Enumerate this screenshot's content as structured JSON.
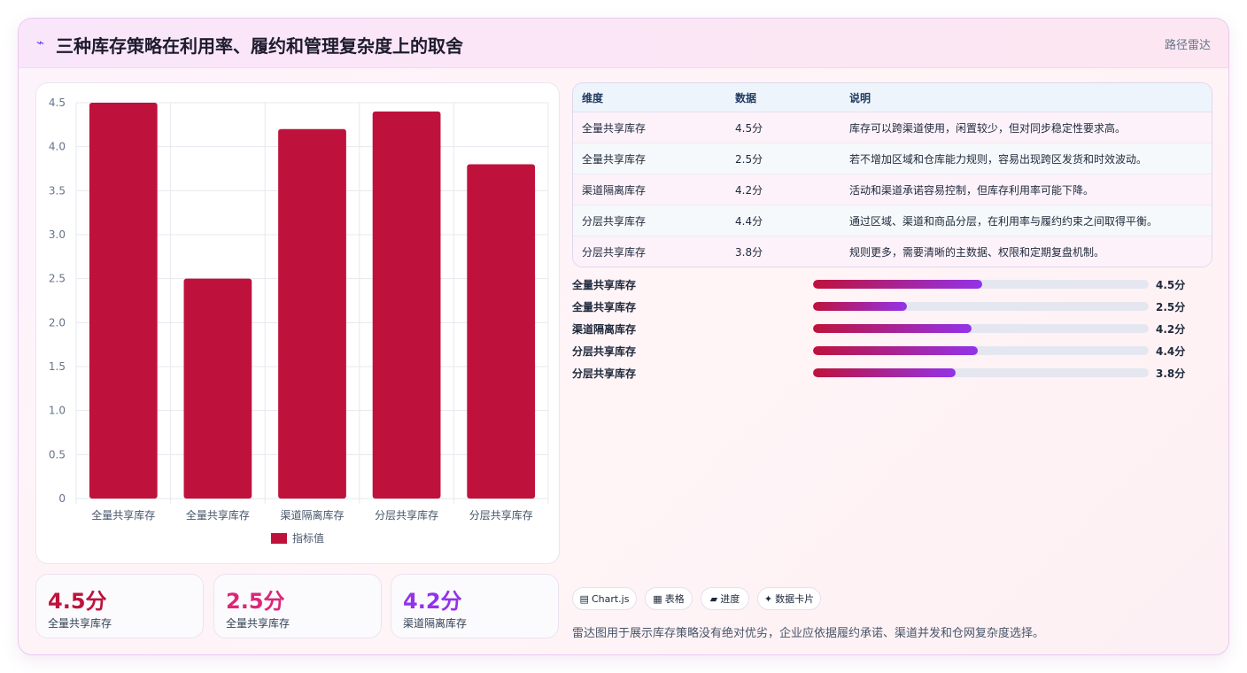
{
  "header": {
    "icon": "⌁",
    "title": "三种库存策略在利用率、履约和管理复杂度上的取舍",
    "badge": "路径雷达"
  },
  "colors": {
    "bar": "#be123c",
    "gradient_start": "#be123c",
    "gradient_end": "#9333ea",
    "kpi_1": "#be123c",
    "kpi_2": "#db2777",
    "kpi_3": "#9333ea"
  },
  "chart_data": {
    "type": "bar",
    "categories": [
      "全量共享库存",
      "全量共享库存",
      "渠道隔离库存",
      "分层共享库存",
      "分层共享库存"
    ],
    "series": [
      {
        "name": "指标值",
        "values": [
          4.5,
          2.5,
          4.2,
          4.4,
          3.8
        ]
      }
    ],
    "ylim": [
      0,
      4.5
    ],
    "yticks": [
      "0",
      "0.5",
      "1.0",
      "1.5",
      "2.0",
      "2.5",
      "3.0",
      "3.5",
      "4.0",
      "4.5"
    ],
    "grid": true,
    "legend": "bottom"
  },
  "kpis": [
    {
      "value": "4.5分",
      "label": "全量共享库存"
    },
    {
      "value": "2.5分",
      "label": "全量共享库存"
    },
    {
      "value": "4.2分",
      "label": "渠道隔离库存"
    }
  ],
  "table": {
    "headers": [
      "维度",
      "数据",
      "说明"
    ],
    "rows": [
      [
        "全量共享库存",
        "4.5分",
        "库存可以跨渠道使用，闲置较少，但对同步稳定性要求高。"
      ],
      [
        "全量共享库存",
        "2.5分",
        "若不增加区域和仓库能力规则，容易出现跨区发货和时效波动。"
      ],
      [
        "渠道隔离库存",
        "4.2分",
        "活动和渠道承诺容易控制，但库存利用率可能下降。"
      ],
      [
        "分层共享库存",
        "4.4分",
        "通过区域、渠道和商品分层，在利用率与履约约束之间取得平衡。"
      ],
      [
        "分层共享库存",
        "3.8分",
        "规则更多，需要清晰的主数据、权限和定期复盘机制。"
      ]
    ]
  },
  "progress": [
    {
      "label": "全量共享库存",
      "value": 4.5,
      "display": "4.5分",
      "fraction": 0.505
    },
    {
      "label": "全量共享库存",
      "value": 2.5,
      "display": "2.5分",
      "fraction": 0.28
    },
    {
      "label": "渠道隔离库存",
      "value": 4.2,
      "display": "4.2分",
      "fraction": 0.472
    },
    {
      "label": "分层共享库存",
      "value": 4.4,
      "display": "4.4分",
      "fraction": 0.49
    },
    {
      "label": "分层共享库存",
      "value": 3.8,
      "display": "3.8分",
      "fraction": 0.425
    }
  ],
  "chips": [
    {
      "icon": "▤",
      "label": "Chart.js"
    },
    {
      "icon": "▦",
      "label": "表格"
    },
    {
      "icon": "▰",
      "label": "进度"
    },
    {
      "icon": "✦",
      "label": "数据卡片"
    }
  ],
  "footnote": "雷达图用于展示库存策略没有绝对优劣，企业应依据履约承诺、渠道并发和仓网复杂度选择。"
}
